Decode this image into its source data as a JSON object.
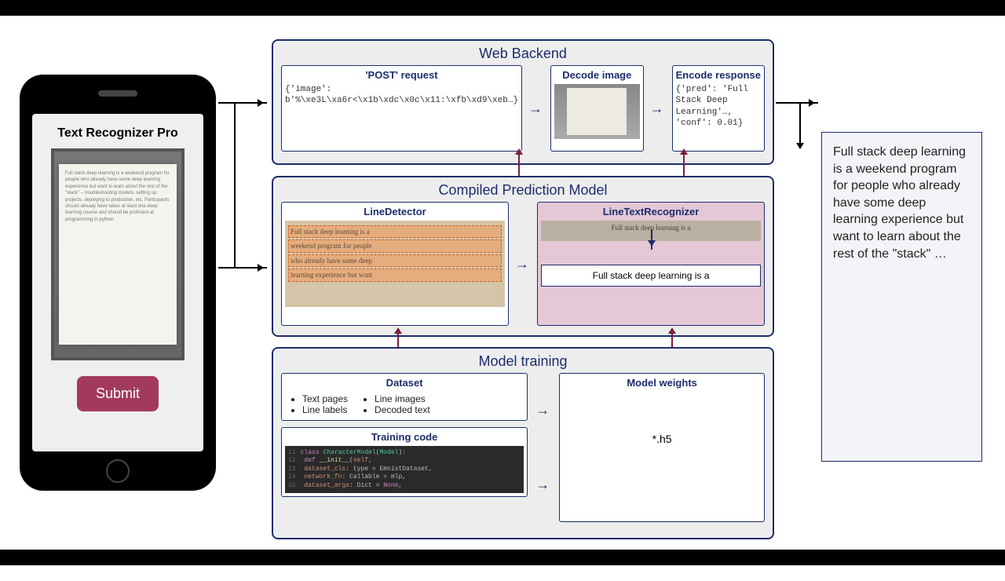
{
  "phone": {
    "app_title": "Text Recognizer Pro",
    "handwritten_preview": "Full stack deep learning is a weekend program for people who already have some deep learning experience but want to learn about the rest of the \"stack\" – troubleshooting models, setting up projects, deploying to production, etc. Participants should already have taken at least one deep learning course and should be proficient at programming in python.",
    "submit_label": "Submit"
  },
  "backend": {
    "title": "Web Backend",
    "post": {
      "title": "'POST' request",
      "body": "{'image': b'%\\xe3L\\xa6r<\\x1b\\xdc\\x0c\\x11:\\xfb\\xd9\\xeb…}"
    },
    "decode": {
      "title": "Decode image"
    },
    "encode": {
      "title": "Encode response",
      "body": "{'pred': 'Full Stack Deep Learning'…, 'conf': 0.01}"
    }
  },
  "model": {
    "title": "Compiled Prediction Model",
    "detector": {
      "title": "LineDetector",
      "lines": [
        "Full stack deep learning is a",
        "weekend program for people",
        "who already have some deep",
        "learning experience but want"
      ]
    },
    "recognizer": {
      "title": "LineTextRecognizer",
      "input_line": "Full stack deep learning is a",
      "output_text": "Full stack deep learning is a"
    }
  },
  "training": {
    "title": "Model training",
    "dataset": {
      "title": "Dataset",
      "col1": [
        "Text pages",
        "Line labels"
      ],
      "col2": [
        "Line images",
        "Decoded text"
      ]
    },
    "code": {
      "title": "Training code",
      "lines": [
        {
          "n": "11",
          "t": "class CharacterModel(Model):"
        },
        {
          "n": "12",
          "t": "    def __init__(self,"
        },
        {
          "n": "13",
          "t": "                 dataset_cls: type = EmnistDataset,"
        },
        {
          "n": "14",
          "t": "                 network_fn: Callable = mlp,"
        },
        {
          "n": "15",
          "t": "                 dataset_args: Dict = None,"
        }
      ]
    },
    "weights": {
      "title": "Model weights",
      "body": "*.h5"
    }
  },
  "output_text": "Full stack deep learning is a weekend program for people who already have some deep learning experience but want to learn about the rest of the \"stack\" …"
}
